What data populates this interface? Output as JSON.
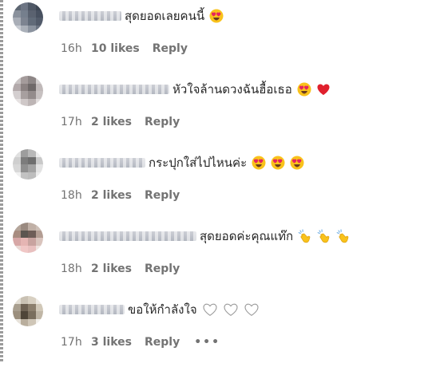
{
  "comments": [
    {
      "text": "สุดยอดเลยคนนี้",
      "time": "16h",
      "likes": "10 likes",
      "reply": "Reply",
      "emojis": [
        "heart-eyes-icon"
      ],
      "avatar_colors": [
        "#5d6672",
        "#6d7584",
        "#4f5866",
        "#3e4754",
        "#8a919c",
        "#757f8d",
        "#5a6270",
        "#485160",
        "#a9aeb7",
        "#7d8491",
        "#616b79",
        "#525b6a",
        "#c7cbd2",
        "#aab0b9",
        "#8b939f",
        "#6b7482"
      ]
    },
    {
      "text": "หัวใจล้านดวงฉันฮื้อเธอ",
      "time": "17h",
      "likes": "2 likes",
      "reply": "Reply",
      "emojis": [
        "heart-eyes-icon",
        "red-heart-icon"
      ],
      "avatar_colors": [
        "#c9c4c4",
        "#a49b9b",
        "#8d8686",
        "#d3cfcf",
        "#b3aaab",
        "#8b8282",
        "#6f6969",
        "#c0b9b9",
        "#d4cfd0",
        "#a79f9f",
        "#938b8b",
        "#c7c1c1",
        "#e6e2e2",
        "#cfc8c8",
        "#bdb5b5",
        "#e1dcdc"
      ]
    },
    {
      "text": "กระปุกใส่ไปไหนค่ะ",
      "time": "18h",
      "likes": "2 likes",
      "reply": "Reply",
      "emojis": [
        "heart-eyes-icon",
        "heart-eyes-icon",
        "heart-eyes-icon"
      ],
      "avatar_colors": [
        "#e0e0e0",
        "#9d9d9d",
        "#b8b8b8",
        "#ededed",
        "#cfcfcf",
        "#7c7c7c",
        "#6e6e6e",
        "#c9c9c9",
        "#d8d8d8",
        "#8f8f8f",
        "#a3a3a3",
        "#e2e2e2",
        "#f0f0f0",
        "#c2c2c2",
        "#bdbdbd",
        "#ececec"
      ]
    },
    {
      "text": "สุดยอดค่ะคุณแท๊ก",
      "time": "18h",
      "likes": "2 likes",
      "reply": "Reply",
      "emojis": [
        "clapping-hands-icon",
        "clapping-hands-icon",
        "clapping-hands-icon"
      ],
      "avatar_colors": [
        "#b4a59a",
        "#9a8a80",
        "#c0b0a6",
        "#cdbfb6",
        "#a88c80",
        "#5b5550",
        "#6e5d57",
        "#b39d93",
        "#d7a7a6",
        "#e5b5b3",
        "#c8a39f",
        "#d9c4bd",
        "#e9d7d3",
        "#f0c7c6",
        "#e8c0bf",
        "#efe4e0"
      ]
    },
    {
      "text": "ขอให้กำลังใจ",
      "time": "17h",
      "likes": "3 likes",
      "reply": "Reply",
      "emojis": [
        "white-heart-icon",
        "white-heart-icon",
        "white-heart-icon"
      ],
      "more": "•••",
      "avatar_colors": [
        "#e2ddd3",
        "#c9c1b3",
        "#d8d0c2",
        "#eeeae3",
        "#a99f8f",
        "#6e6253",
        "#8c7f6d",
        "#d1c8b8",
        "#9b8f7d",
        "#4f4538",
        "#7a6e5d",
        "#c0b6a6",
        "#e7e2da",
        "#b9ae9d",
        "#cfc6b7",
        "#f2efea"
      ]
    }
  ]
}
